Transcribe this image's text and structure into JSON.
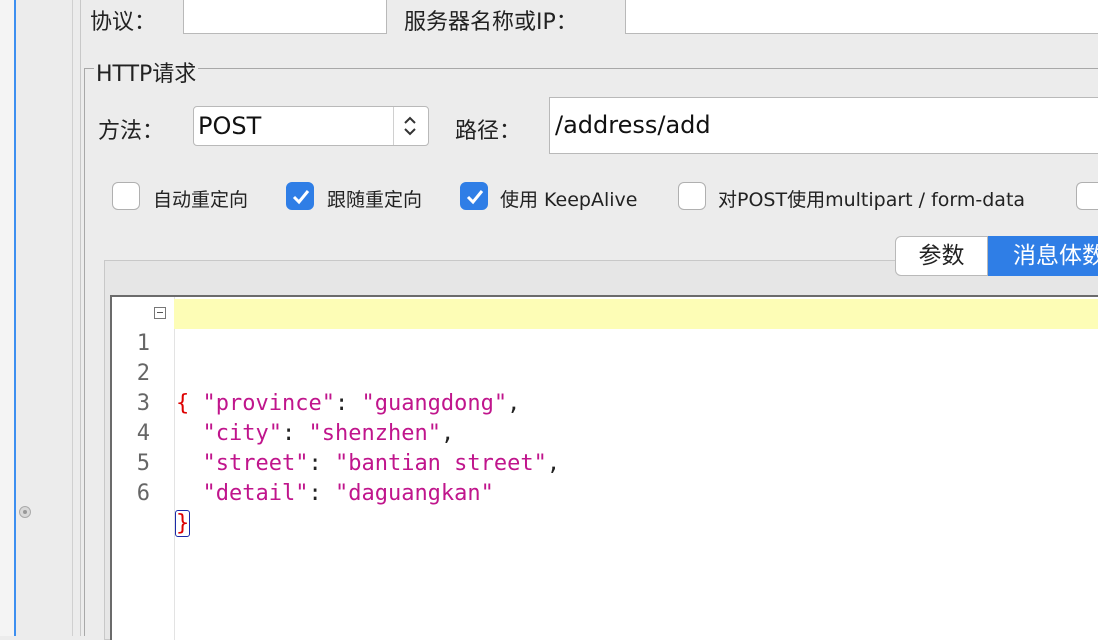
{
  "top_row": {
    "protocol_label": "协议：",
    "protocol_value": "",
    "server_label": "服务器名称或IP：",
    "server_value": ""
  },
  "http_request": {
    "group_title": "HTTP请求",
    "method_label": "方法：",
    "method_value": "POST",
    "path_label": "路径：",
    "path_value": "/address/add"
  },
  "options": [
    {
      "label": "自动重定向",
      "checked": false
    },
    {
      "label": "跟随重定向",
      "checked": true
    },
    {
      "label": "使用 KeepAlive",
      "checked": true
    },
    {
      "label": "对POST使用multipart / form-data",
      "checked": false
    }
  ],
  "tabs": {
    "params": "参数",
    "body": "消息体数"
  },
  "editor": {
    "line_numbers": [
      "1",
      "2",
      "3",
      "4",
      "5",
      "6"
    ],
    "lines": [
      {
        "open": "{"
      },
      {
        "key": "\"province\"",
        "sep": ": ",
        "value": "\"guangdong\"",
        "tail": ","
      },
      {
        "key": "\"city\"",
        "sep": ": ",
        "value": "\"shenzhen\"",
        "tail": ","
      },
      {
        "key": "\"street\"",
        "sep": ": ",
        "value": "\"bantian street\"",
        "tail": ","
      },
      {
        "key": "\"detail\"",
        "sep": ": ",
        "value": "\"daguangkan\"",
        "tail": ""
      },
      {
        "close": "}"
      }
    ]
  },
  "colors": {
    "accent": "#2f7ee6",
    "json_string": "#c0158c",
    "brace": "#dd0000",
    "current_line": "#fdfdb6"
  }
}
